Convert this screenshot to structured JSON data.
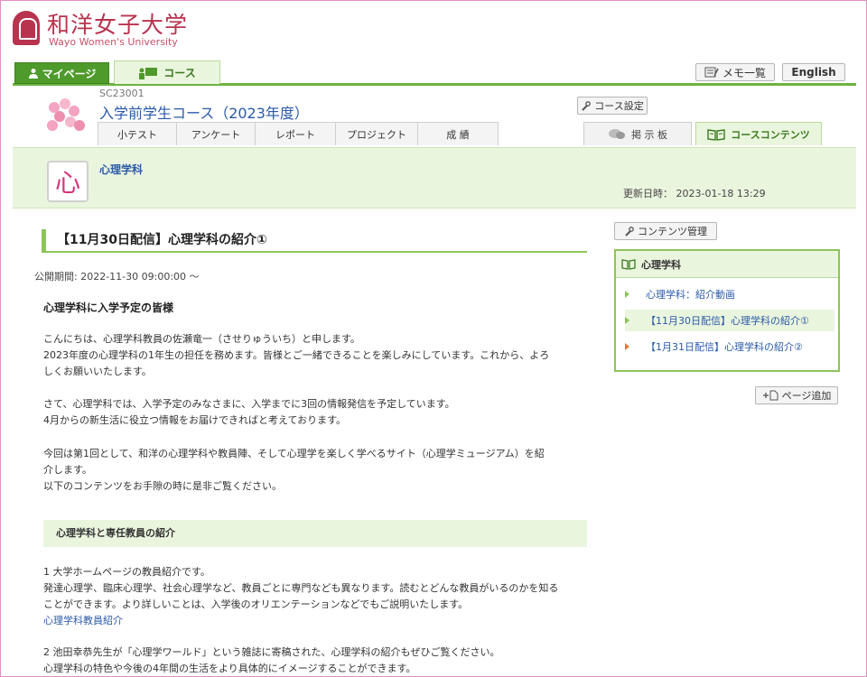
{
  "header": {
    "logo_jp": "和洋女子大学",
    "logo_en": "Wayo Women's University"
  },
  "topnav": {
    "mypage_label": "マイページ",
    "course_label": "コース",
    "memo_label": "メモ一覧",
    "english_label": "English"
  },
  "course": {
    "code": "SC23001",
    "title": "入学前学生コース（2023年度）",
    "setting_label": "コース設定",
    "tabs": [
      {
        "label": "小テスト"
      },
      {
        "label": "アンケート"
      },
      {
        "label": "レポート"
      },
      {
        "label": "プロジェクト"
      },
      {
        "label": "成 績"
      }
    ],
    "board_label": "掲 示 板",
    "contents_label": "コースコンテンツ"
  },
  "band": {
    "icon_char": "心",
    "title": "心理学科",
    "updated": "更新日時： 2023-01-18 13:29"
  },
  "article": {
    "heading": "【11月30日配信】心理学科の紹介①",
    "pub_period": "公開期間: 2022-11-30 09:00:00 ～",
    "greeting": "心理学科に入学予定の皆様",
    "p1_l1": "こんにちは、心理学科教員の佐瀬竜一（させりゅういち）と申します。",
    "p1_l2": "2023年度の心理学科の1年生の担任を務めます。皆様とご一緒できることを楽しみにしています。これから、よろ",
    "p1_l3": "しくお願いいたします。",
    "p2_l1": "さて、心理学科では、入学予定のみなさまに、入学までに3回の情報発信を予定しています。",
    "p2_l2": "4月からの新生活に役立つ情報をお届けできればと考えております。",
    "p3_l1": "今回は第1回として、和洋の心理学科や教員陣、そして心理学を楽しく学べるサイト（心理学ミュージアム）を紹",
    "p3_l2": "介します。",
    "p3_l3": "以下のコンテンツをお手隙の時に是非ご覧ください。",
    "section_title": "心理学科と専任教員の紹介",
    "s1_l1": "1  大学ホームページの教員紹介です。",
    "s1_l2": "発達心理学、臨床心理学、社会心理学など、教員ごとに専門なども異なります。読むとどんな教員がいるのかを知る",
    "s1_l3": "ことができます。より詳しいことは、入学後のオリエンテーションなどでもご説明いたします。",
    "s1_link": "心理学科教員紹介",
    "s2_l1": "2  池田幸恭先生が「心理学ワールド」という雑誌に寄稿された、心理学科の紹介もぜひご覧ください。",
    "s2_l2": "心理学科の特色や今後の4年間の生活をより具体的にイメージすることができます。"
  },
  "sidebar": {
    "manage_label": "コンテンツ管理",
    "box_title": "心理学科",
    "items": [
      {
        "label": "心理学科：紹介動画"
      },
      {
        "label": "【11月30日配信】心理学科の紹介①"
      },
      {
        "label": "【1月31日配信】心理学科の紹介②"
      }
    ],
    "add_page_label": "ページ追加"
  }
}
